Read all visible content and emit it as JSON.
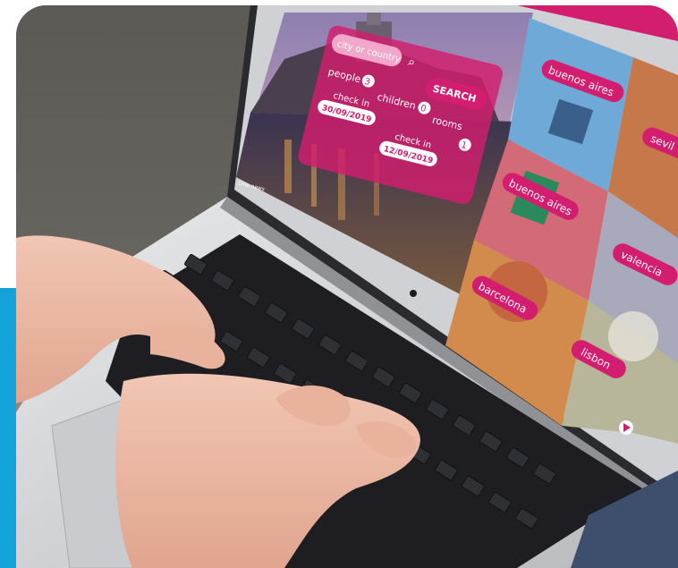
{
  "scene": {
    "description_free": true,
    "accent_color": "#14a4d9",
    "brand_color": "#d31d6e"
  },
  "search_form": {
    "city_placeholder": "city or country",
    "search_icon": "search-icon",
    "search_label": "SEARCH",
    "people_label": "people",
    "people_value": "3",
    "children_label": "children",
    "children_value": "0",
    "rooms_label": "rooms",
    "rooms_value": "1",
    "checkin_label": "check in",
    "checkin_value": "30/09/2019",
    "checkout_label": "check in",
    "checkout_value": "12/09/2019"
  },
  "destinations": [
    {
      "label": "buenos aires"
    },
    {
      "label": "sevil"
    },
    {
      "label": "buenos aires"
    },
    {
      "label": "valencia"
    },
    {
      "label": "barcelona"
    },
    {
      "label": "lisbon"
    }
  ],
  "footer_small_text": "cme news"
}
